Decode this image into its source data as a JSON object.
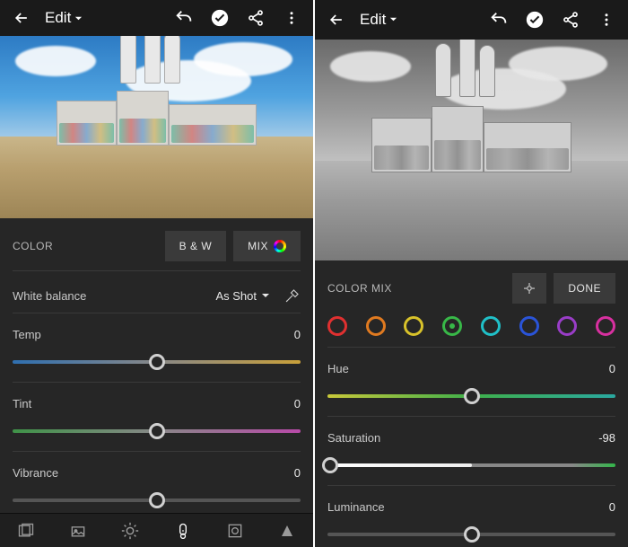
{
  "left": {
    "header": {
      "title": "Edit"
    },
    "panel_title": "COLOR",
    "bw_btn": "B & W",
    "mix_btn": "MIX",
    "wb_label": "White balance",
    "wb_value": "As Shot",
    "sliders": {
      "temp": {
        "label": "Temp",
        "value": "0",
        "pos": 50
      },
      "tint": {
        "label": "Tint",
        "value": "0",
        "pos": 50
      },
      "vibrance": {
        "label": "Vibrance",
        "value": "0",
        "pos": 50
      }
    }
  },
  "right": {
    "header": {
      "title": "Edit"
    },
    "panel_title": "COLOR MIX",
    "done_btn": "DONE",
    "swatches": [
      {
        "name": "red",
        "color": "#e03030"
      },
      {
        "name": "orange",
        "color": "#e07a20"
      },
      {
        "name": "yellow",
        "color": "#d8c22a"
      },
      {
        "name": "green",
        "color": "#38b848",
        "active": true
      },
      {
        "name": "aqua",
        "color": "#20c0c8"
      },
      {
        "name": "blue",
        "color": "#2a54d8"
      },
      {
        "name": "purple",
        "color": "#9a3dc8"
      },
      {
        "name": "magenta",
        "color": "#d830a0"
      }
    ],
    "sliders": {
      "hue": {
        "label": "Hue",
        "value": "0",
        "pos": 50
      },
      "saturation": {
        "label": "Saturation",
        "value": "-98",
        "pos": 1
      },
      "luminance": {
        "label": "Luminance",
        "value": "0",
        "pos": 50
      }
    }
  }
}
